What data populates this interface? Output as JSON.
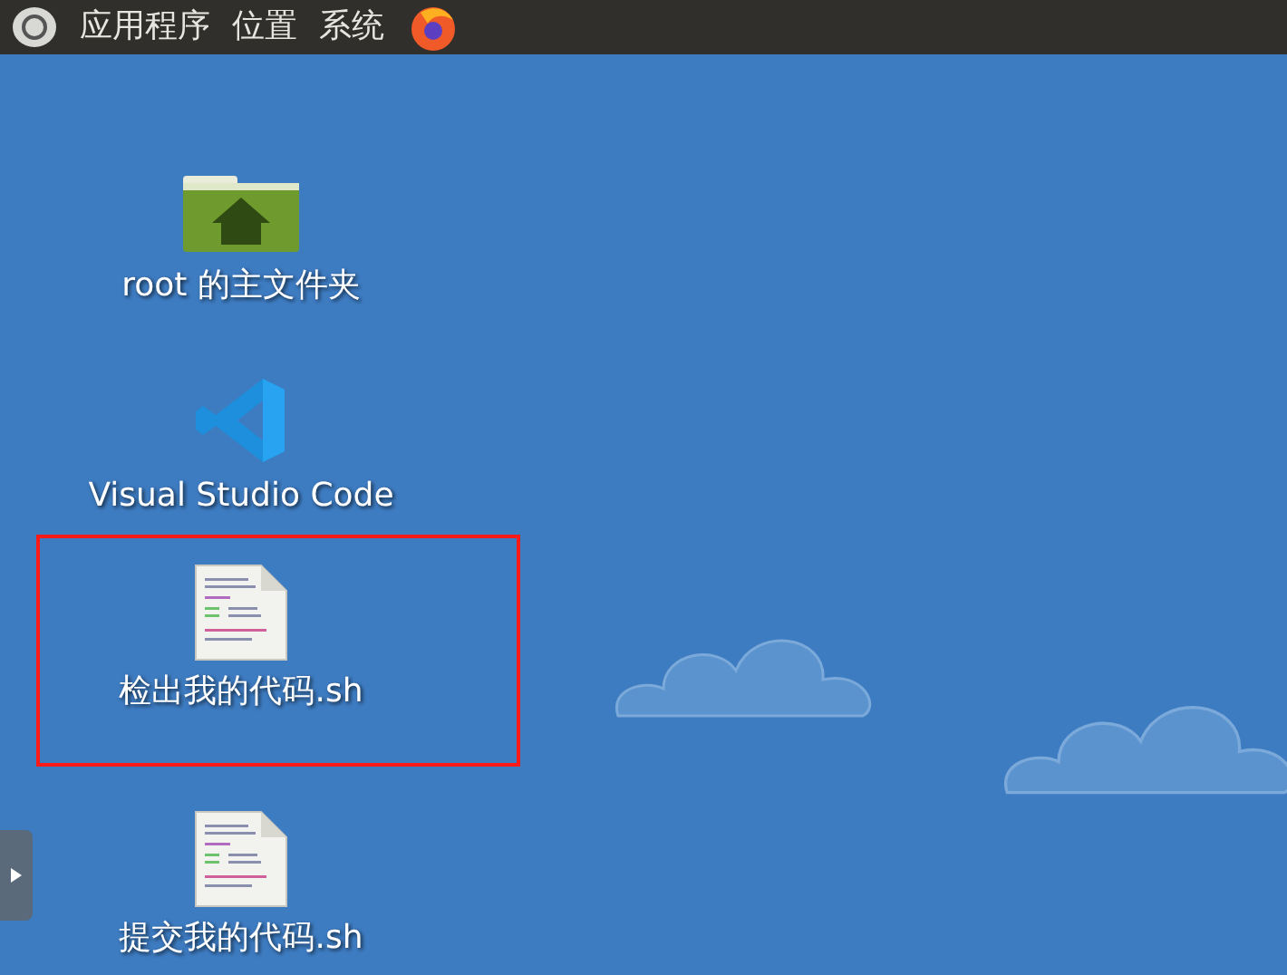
{
  "top_panel": {
    "menus": [
      {
        "label": "应用程序"
      },
      {
        "label": "位置"
      },
      {
        "label": "系统"
      }
    ]
  },
  "desktop_icons": [
    {
      "kind": "folder",
      "label": "root 的主文件夹",
      "highlighted": false
    },
    {
      "kind": "vscode",
      "label": "Visual Studio Code",
      "highlighted": false
    },
    {
      "kind": "script",
      "label": "检出我的代码.sh",
      "highlighted": true
    },
    {
      "kind": "script",
      "label": "提交我的代码.sh",
      "highlighted": false
    }
  ]
}
